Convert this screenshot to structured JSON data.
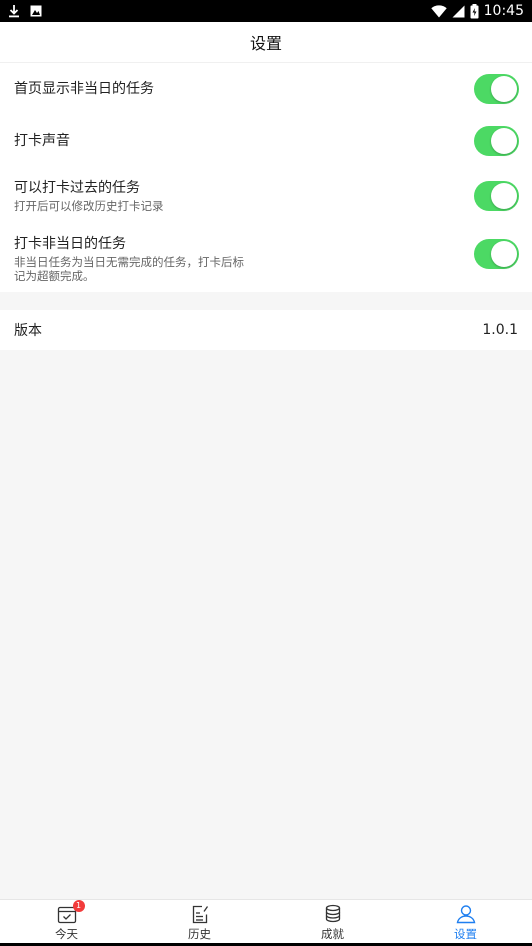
{
  "status_bar": {
    "time": "10:45",
    "left_icons": [
      "download-icon",
      "photo-icon"
    ],
    "right_icons": [
      "wifi-icon",
      "signal-icon",
      "battery-icon"
    ]
  },
  "header": {
    "title": "设置"
  },
  "settings": [
    {
      "label": "首页显示非当日的任务",
      "desc": "",
      "enabled": true
    },
    {
      "label": "打卡声音",
      "desc": "",
      "enabled": true
    },
    {
      "label": "可以打卡过去的任务",
      "desc": "打开后可以修改历史打卡记录",
      "enabled": true
    },
    {
      "label": "打卡非当日的任务",
      "desc_line1": "非当日任务为当日无需完成的任务，打卡后标",
      "desc_line2": "记为超额完成。",
      "enabled": true
    }
  ],
  "version": {
    "label": "版本",
    "value": "1.0.1"
  },
  "tabs": [
    {
      "label": "今天",
      "icon": "calendar-check-icon",
      "badge": "1"
    },
    {
      "label": "历史",
      "icon": "edit-document-icon"
    },
    {
      "label": "成就",
      "icon": "database-stack-icon"
    },
    {
      "label": "设置",
      "icon": "user-icon",
      "active": true
    }
  ],
  "colors": {
    "toggle_on": "#4cd964",
    "accent": "#1f7ff0",
    "badge": "#f23b3b",
    "page_bg": "#f6f6f6"
  }
}
